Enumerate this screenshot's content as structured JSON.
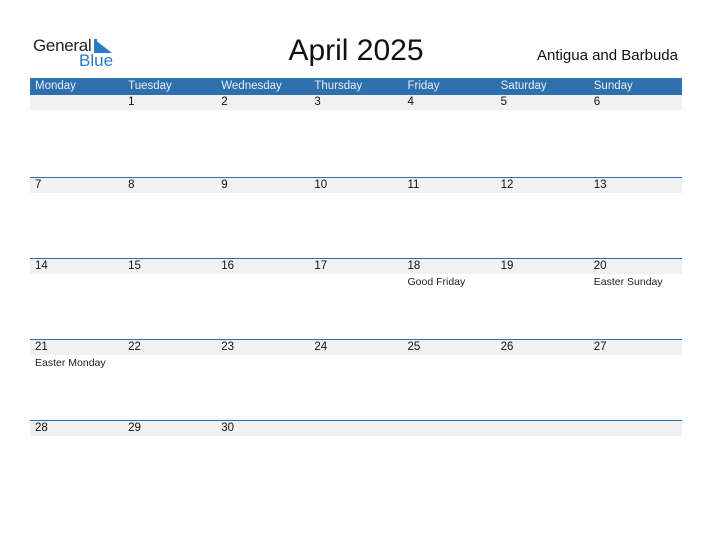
{
  "logo": {
    "general": "General",
    "blue": "Blue"
  },
  "title": "April 2025",
  "country": "Antigua and Barbuda",
  "weekdays": [
    "Monday",
    "Tuesday",
    "Wednesday",
    "Thursday",
    "Friday",
    "Saturday",
    "Sunday"
  ],
  "weeks": [
    {
      "days": [
        "",
        "1",
        "2",
        "3",
        "4",
        "5",
        "6"
      ],
      "holidays": [
        "",
        "",
        "",
        "",
        "",
        "",
        ""
      ]
    },
    {
      "days": [
        "7",
        "8",
        "9",
        "10",
        "11",
        "12",
        "13"
      ],
      "holidays": [
        "",
        "",
        "",
        "",
        "",
        "",
        ""
      ]
    },
    {
      "days": [
        "14",
        "15",
        "16",
        "17",
        "18",
        "19",
        "20"
      ],
      "holidays": [
        "",
        "",
        "",
        "",
        "Good Friday",
        "",
        "Easter Sunday"
      ]
    },
    {
      "days": [
        "21",
        "22",
        "23",
        "24",
        "25",
        "26",
        "27"
      ],
      "holidays": [
        "Easter Monday",
        "",
        "",
        "",
        "",
        "",
        ""
      ]
    },
    {
      "days": [
        "28",
        "29",
        "30",
        "",
        "",
        "",
        ""
      ],
      "holidays": [
        "",
        "",
        "",
        "",
        "",
        "",
        ""
      ]
    }
  ]
}
